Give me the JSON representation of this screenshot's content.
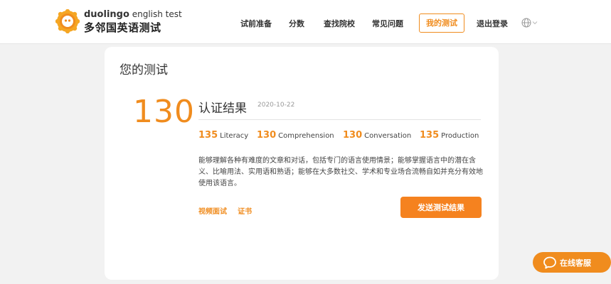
{
  "brand": {
    "logo_en_bold": "duolingo",
    "logo_en_rest": " english test",
    "logo_cn": "多邻国英语测试",
    "accent_color": "#f08c1e"
  },
  "nav": {
    "items": [
      {
        "label": "试前准备"
      },
      {
        "label": "分数"
      },
      {
        "label": "查找院校"
      },
      {
        "label": "常见问题"
      },
      {
        "label": "我的测试",
        "active": true
      },
      {
        "label": "退出登录"
      }
    ],
    "language_icon": "globe-icon"
  },
  "card": {
    "title": "您的测试",
    "overall_score": "130",
    "result_title": "认证结果",
    "date": "2020-10-22",
    "subscores": [
      {
        "value": "135",
        "name": "Literacy"
      },
      {
        "value": "130",
        "name": "Comprehension"
      },
      {
        "value": "130",
        "name": "Conversation"
      },
      {
        "value": "135",
        "name": "Production"
      }
    ],
    "description": "能够理解各种有难度的文章和对话，包括专门的语言使用情景；能够掌握语言中的潜在含义、比喻用法、实用语和熟语；能够在大多数社交、学术和专业场合流畅自如并充分有效地使用该语言。",
    "links": [
      {
        "label": "视频面试"
      },
      {
        "label": "证书"
      }
    ],
    "send_button": "发送测试结果"
  },
  "chat": {
    "label": "在线客服",
    "icon": "chat-bubble-icon"
  }
}
